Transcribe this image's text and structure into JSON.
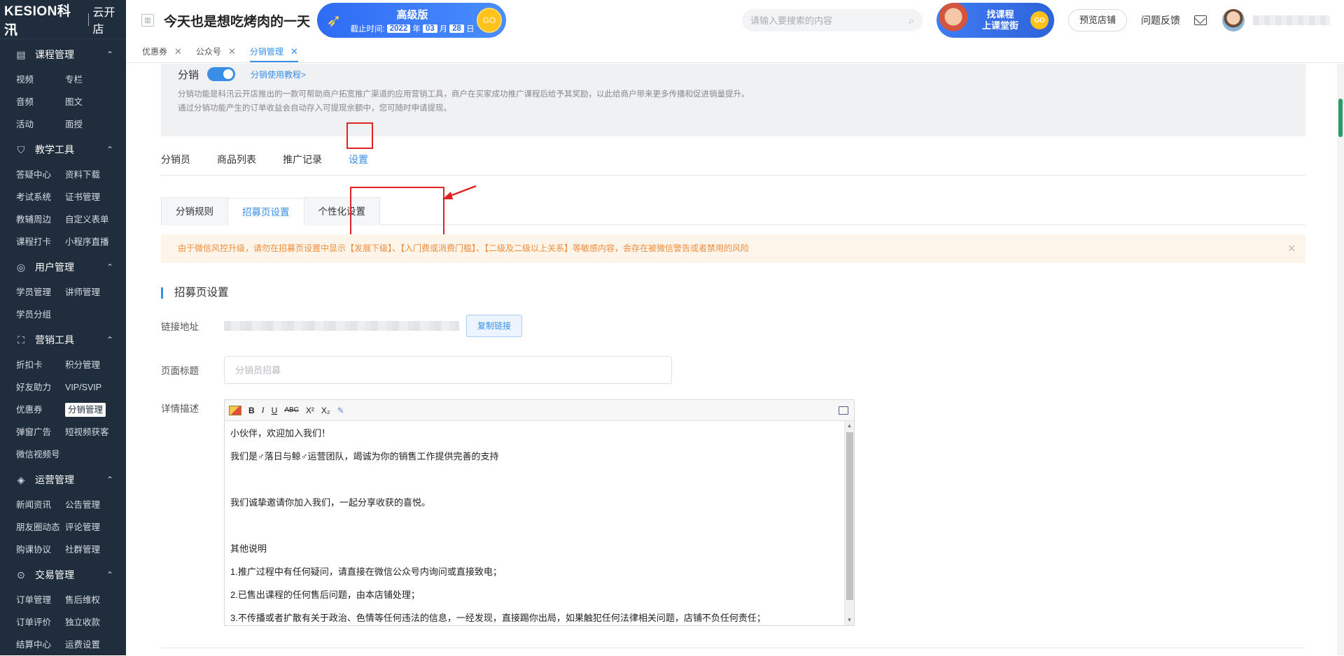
{
  "brand": {
    "logo": "KESION科汛",
    "store": "云开店"
  },
  "sidebar": {
    "sections": [
      {
        "title": "课程管理",
        "icon": "course-icon",
        "items": [
          "视频",
          "专栏",
          "音频",
          "图文",
          "活动",
          "面授"
        ]
      },
      {
        "title": "教学工具",
        "icon": "teaching-tools-icon",
        "items": [
          "答疑中心",
          "资料下载",
          "考试系统",
          "证书管理",
          "教辅周边",
          "自定义表单",
          "课程打卡",
          "小程序直播"
        ]
      },
      {
        "title": "用户管理",
        "icon": "user-icon",
        "items": [
          "学员管理",
          "讲师管理",
          "学员分组"
        ]
      },
      {
        "title": "营销工具",
        "icon": "gift-icon",
        "items": [
          "折扣卡",
          "积分管理",
          "好友助力",
          "VIP/SVIP",
          "优惠券",
          "分销管理",
          "弹窗广告",
          "短视频获客",
          "微信视频号"
        ]
      },
      {
        "title": "运营管理",
        "icon": "layers-icon",
        "items": [
          "新闻资讯",
          "公告管理",
          "朋友圈动态",
          "评论管理",
          "购课协议",
          "社群管理"
        ]
      },
      {
        "title": "交易管理",
        "icon": "coin-icon",
        "items": [
          "订单管理",
          "售后维权",
          "订单评价",
          "独立收款",
          "结算中心",
          "运费设置"
        ]
      }
    ],
    "active_item": "分销管理"
  },
  "header": {
    "title": "今天也是想吃烤肉的一天",
    "promo": {
      "version": "高级版",
      "expire_label": "截止时间:",
      "year": "2022",
      "y": "年",
      "month": "03",
      "m": "月",
      "day": "28",
      "d": "日",
      "go": "GO"
    },
    "search_placeholder": "请输入要搜索的内容",
    "course_banner": {
      "line1": "找课程",
      "line2": "上课堂街",
      "go": "GO"
    },
    "preview_btn": "预览店铺",
    "feedback": "问题反馈"
  },
  "page_tabs": [
    {
      "label": "优惠券",
      "active": false
    },
    {
      "label": "公众号",
      "active": false
    },
    {
      "label": "分销管理",
      "active": true
    }
  ],
  "intro": {
    "label": "分销",
    "switch_on": true,
    "help_link": "分销使用教程>",
    "desc1": "分销功能是科汛云开店推出的一款可帮助商户拓宽推广渠道的应用营销工具，商户在买家成功推广课程后给予其奖励，以此给商户带来更多传播和促进销量提升。",
    "desc2": "通过分销功能产生的订单收益会自动存入可提现余额中，您可随时申请提现。"
  },
  "main_tabs": [
    {
      "label": "分销员",
      "active": false
    },
    {
      "label": "商品列表",
      "active": false
    },
    {
      "label": "推广记录",
      "active": false
    },
    {
      "label": "设置",
      "active": true
    }
  ],
  "sub_tabs": [
    {
      "label": "分销规则",
      "active": false
    },
    {
      "label": "招募页设置",
      "active": true
    },
    {
      "label": "个性化设置",
      "active": false
    }
  ],
  "warning": "由于微信风控升级，请勿在招募页设置中显示【发展下级】、【入门费或消费门槛】、【二级及二级以上关系】等敏感内容，会存在被微信警告或者禁用的风险",
  "section_title": "招募页设置",
  "form": {
    "link_label": "链接地址",
    "copy_btn": "复制链接",
    "title_label": "页面标题",
    "title_placeholder": "分销员招募",
    "desc_label": "详情描述"
  },
  "editor": {
    "toolbar": {
      "bold": "B",
      "italic": "I",
      "underline": "U",
      "strike": "ABC",
      "sup": "X²",
      "sub": "X₂"
    },
    "lines": [
      "小伙伴，欢迎加入我们！",
      "我们是♂落日与鲸♂运营团队，竭诚为你的销售工作提供完善的支持",
      "",
      "我们诚挚邀请你加入我们，一起分享收获的喜悦。",
      "",
      "其他说明",
      "1.推广过程中有任何疑问，请直接在微信公众号内询问或直接致电；",
      "2.已售出课程的任何售后问题，由本店铺处理；",
      "3.不传播或者扩散有关于政治、色情等任何违法的信息，一经发现，直接踢你出局，如果触犯任何法律相关问题，店铺不负任何责任；"
    ]
  },
  "colors": {
    "sidebar": "#1f2d3d",
    "accent": "#3a8ee6",
    "warning_bg": "#fdf5ea",
    "warning_text": "#f08c3a",
    "annotation": "#e02424"
  }
}
